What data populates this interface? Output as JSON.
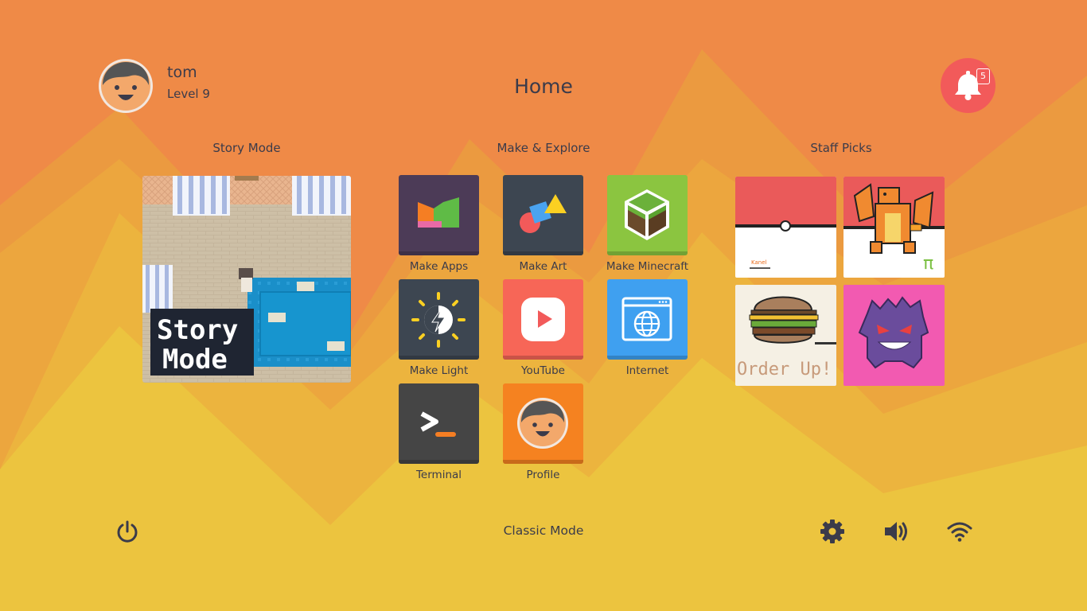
{
  "user": {
    "name": "tom",
    "level": "Level 9"
  },
  "page": {
    "title": "Home"
  },
  "notifications": {
    "count": "5",
    "icon": "bell-icon"
  },
  "sections": {
    "story": "Story Mode",
    "make": "Make & Explore",
    "picks": "Staff Picks"
  },
  "story_card": {
    "line1": "Story",
    "line2": "Mode"
  },
  "apps": [
    {
      "label": "Make Apps",
      "color": "#4c3b57",
      "icon": "make-apps-icon"
    },
    {
      "label": "Make Art",
      "color": "#3d4651",
      "icon": "make-art-icon"
    },
    {
      "label": "Make Minecraft",
      "color": "#8bc540",
      "icon": "minecraft-block-icon"
    },
    {
      "label": "Make Light",
      "color": "#3d4651",
      "icon": "make-light-icon"
    },
    {
      "label": "YouTube",
      "color": "#f76657",
      "icon": "youtube-icon"
    },
    {
      "label": "Internet",
      "color": "#3fa0f0",
      "icon": "internet-globe-icon"
    },
    {
      "label": "Terminal",
      "color": "#454545",
      "icon": "terminal-icon"
    },
    {
      "label": "Profile",
      "color": "#f58220",
      "icon": "profile-avatar-icon"
    }
  ],
  "staff_picks": {
    "pokeball_caption": "Kanel",
    "order_up": "Order Up!",
    "pi": "π"
  },
  "footer": {
    "classic_mode": "Classic Mode"
  },
  "colors": {
    "bg_orange": "#ef8a47",
    "bg_yellow": "#ecc43f",
    "accent_red": "#f25a5a",
    "text": "#3b3b4a"
  }
}
